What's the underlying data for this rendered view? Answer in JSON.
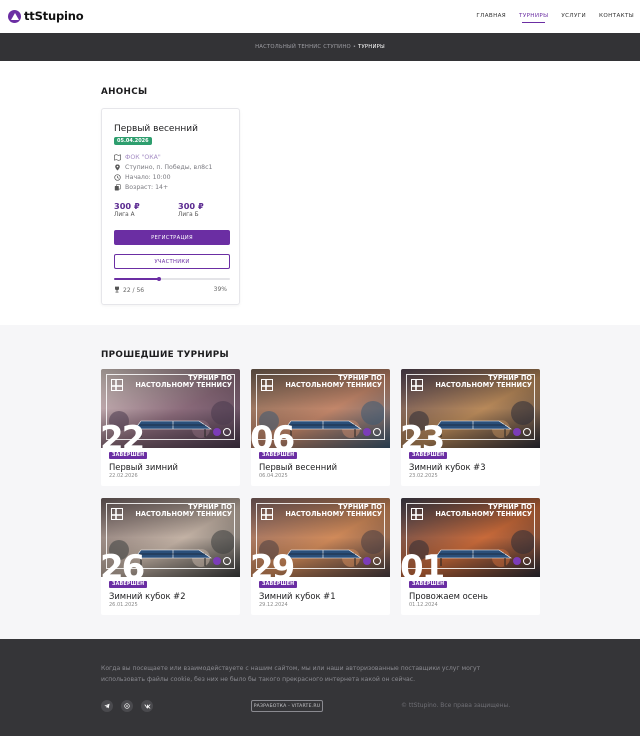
{
  "site": {
    "logo_text": "ttStupino"
  },
  "nav": {
    "items": [
      {
        "label": "ГЛАВНАЯ",
        "active": false
      },
      {
        "label": "ТУРНИРЫ",
        "active": true
      },
      {
        "label": "УСЛУГИ",
        "active": false
      },
      {
        "label": "КОНТАКТЫ",
        "active": false
      }
    ]
  },
  "breadcrumb": {
    "parent": "НАСТОЛЬНЫЙ ТЕННИС СТУПИНО",
    "separator": "•",
    "current": "ТУРНИРЫ"
  },
  "announcements": {
    "title": "АНОНСЫ",
    "event": {
      "title": "Первый весенний",
      "date": "05.04.2026",
      "venue": "ФОК \"ОКА\"",
      "address": "Ступино, п. Победы, вл8с1",
      "start": "Начало: 10:00",
      "age": "Возраст: 14+",
      "price_a": "300 ₽",
      "league_a": "Лига А",
      "price_b": "300 ₽",
      "league_b": "Лига Б",
      "register_label": "РЕГИСТРАЦИЯ",
      "participants_label": "УЧАСТНИКИ",
      "progress_text": "22 / 56",
      "progress_percent": "39%",
      "progress_value": 0.39
    }
  },
  "past": {
    "title": "ПРОШЕДШИЕ ТУРНИРЫ",
    "banner_line1": "ТУРНИР ПО",
    "banner_line2": "НАСТОЛЬНОМУ ТЕННИСУ",
    "cards": [
      {
        "day": "22",
        "status": "ЗАВЕРШЕН",
        "name": "Первый зимний",
        "date": "22.02.2026",
        "palette": [
          "#e6d8d2",
          "#8a6a7a",
          "#4a3a4e"
        ]
      },
      {
        "day": "06",
        "status": "ЗАВЕРШЕН",
        "name": "Первый весенний",
        "date": "06.04.2025",
        "palette": [
          "#7e6a5a",
          "#c2866a",
          "#3d5a74"
        ]
      },
      {
        "day": "23",
        "status": "ЗАВЕРШЕН",
        "name": "Зимний кубок #3",
        "date": "23.02.2025",
        "palette": [
          "#5a4a5a",
          "#b8895a",
          "#2d2d38"
        ]
      },
      {
        "day": "26",
        "status": "ЗАВЕРШЕН",
        "name": "Зимний кубок #2",
        "date": "26.01.2025",
        "palette": [
          "#7a6a6a",
          "#c3b2a5",
          "#3d3f3f"
        ]
      },
      {
        "day": "29",
        "status": "ЗАВЕРШЕН",
        "name": "Зимний кубок #1",
        "date": "29.12.2024",
        "palette": [
          "#8a6b6a",
          "#d08a5a",
          "#4a3e42"
        ]
      },
      {
        "day": "01",
        "status": "ЗАВЕРШЕН",
        "name": "Провожаем осень",
        "date": "01.12.2024",
        "palette": [
          "#4a4654",
          "#c86a3a",
          "#2f2d36"
        ]
      }
    ]
  },
  "footer": {
    "cookie_text": "Когда вы посещаете или взаимодействуете с нашим сайтом, мы или наши авторизованные поставщики услуг могут использовать файлы cookie, без них не было бы такого прекрасного интернета какой он сейчас.",
    "social": [
      "telegram-icon",
      "whatsapp-icon",
      "vk-icon"
    ],
    "dev_badge": "РАЗРАБОТКА - VITARTE.RU",
    "copyright": "© ttStupino. Все права защищены."
  },
  "colors": {
    "accent": "#6b2ea3",
    "date_badge": "#2e9e6e",
    "dark": "#333336"
  }
}
